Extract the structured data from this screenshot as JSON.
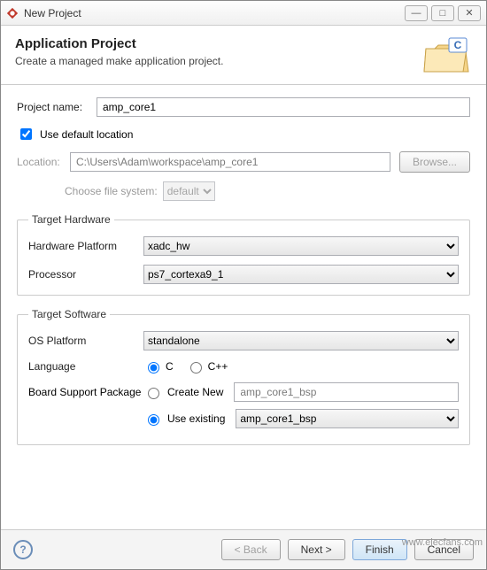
{
  "window": {
    "title": "New Project"
  },
  "header": {
    "title": "Application Project",
    "subtitle": "Create a managed make application project."
  },
  "form": {
    "project_name_label": "Project name:",
    "project_name": "amp_core1",
    "use_default_label": "Use default location",
    "use_default_checked": true,
    "location_label": "Location:",
    "location_value": "C:\\Users\\Adam\\workspace\\amp_core1",
    "browse_label": "Browse...",
    "choose_fs_label": "Choose file system:",
    "fs_value": "default"
  },
  "hw": {
    "legend": "Target Hardware",
    "platform_label": "Hardware Platform",
    "platform_value": "xadc_hw",
    "processor_label": "Processor",
    "processor_value": "ps7_cortexa9_1"
  },
  "sw": {
    "legend": "Target Software",
    "os_label": "OS Platform",
    "os_value": "standalone",
    "lang_label": "Language",
    "lang_c": "C",
    "lang_cpp": "C++",
    "bsp_label": "Board Support Package",
    "bsp_create_label": "Create New",
    "bsp_create_value": "amp_core1_bsp",
    "bsp_use_label": "Use existing",
    "bsp_use_value": "amp_core1_bsp"
  },
  "footer": {
    "back": "< Back",
    "next": "Next >",
    "finish": "Finish",
    "cancel": "Cancel"
  },
  "watermark": "www.elecfans.com"
}
